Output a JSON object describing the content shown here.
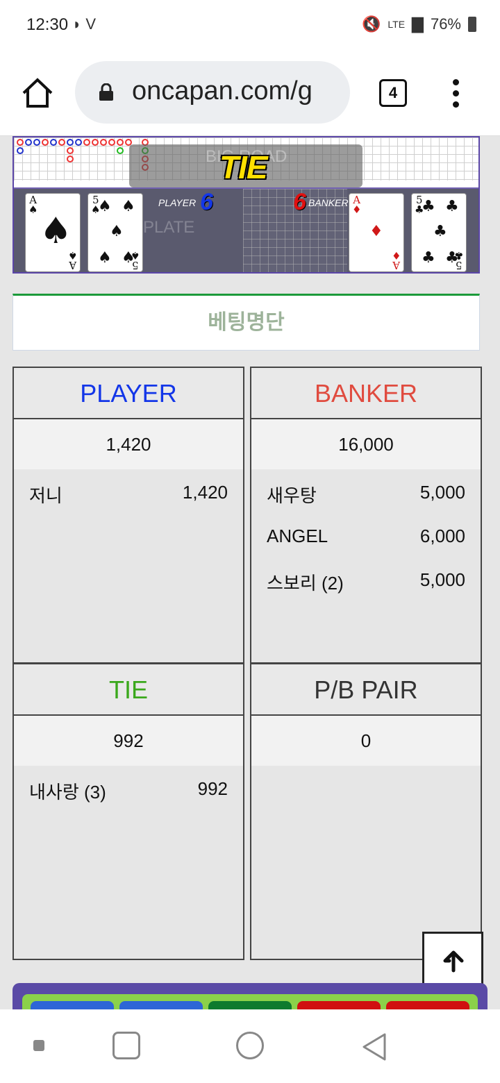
{
  "status_bar": {
    "time": "12:30",
    "network": "LTE",
    "battery": "76%"
  },
  "browser": {
    "url": "oncapan.com/g",
    "tab_count": "4"
  },
  "game": {
    "result_banner": "TIE",
    "road_label": "BIG ROAD",
    "plate_label": "PLATE",
    "player_label": "PLAYER",
    "player_score": "6",
    "banker_label": "BANKER",
    "banker_score": "6",
    "player_cards": [
      {
        "rank": "A",
        "suit": "spade"
      },
      {
        "rank": "5",
        "suit": "spade"
      }
    ],
    "banker_cards": [
      {
        "rank": "A",
        "suit": "diamond"
      },
      {
        "rank": "5",
        "suit": "club"
      }
    ]
  },
  "betting_list_title": "베팅명단",
  "panels": {
    "player": {
      "title": "PLAYER",
      "title_color": "#1336e8",
      "total": "1,420",
      "bets": [
        {
          "name": "저니",
          "amount": "1,420"
        }
      ]
    },
    "banker": {
      "title": "BANKER",
      "title_color": "#e04b3f",
      "total": "16,000",
      "bets": [
        {
          "name": "새우탕",
          "amount": "5,000"
        },
        {
          "name": "ANGEL",
          "amount": "6,000"
        },
        {
          "name": "스보리 (2)",
          "amount": "5,000"
        }
      ]
    },
    "tie": {
      "title": "TIE",
      "title_color": "#3aa81c",
      "total": "992",
      "bets": [
        {
          "name": "내사랑 (3)",
          "amount": "992"
        }
      ]
    },
    "pair": {
      "title": "P/B PAIR",
      "title_color": "#333333",
      "total": "0",
      "bets": []
    }
  },
  "colors": {
    "accent_green": "#1b9a3a",
    "game_border": "#5b46a8"
  }
}
